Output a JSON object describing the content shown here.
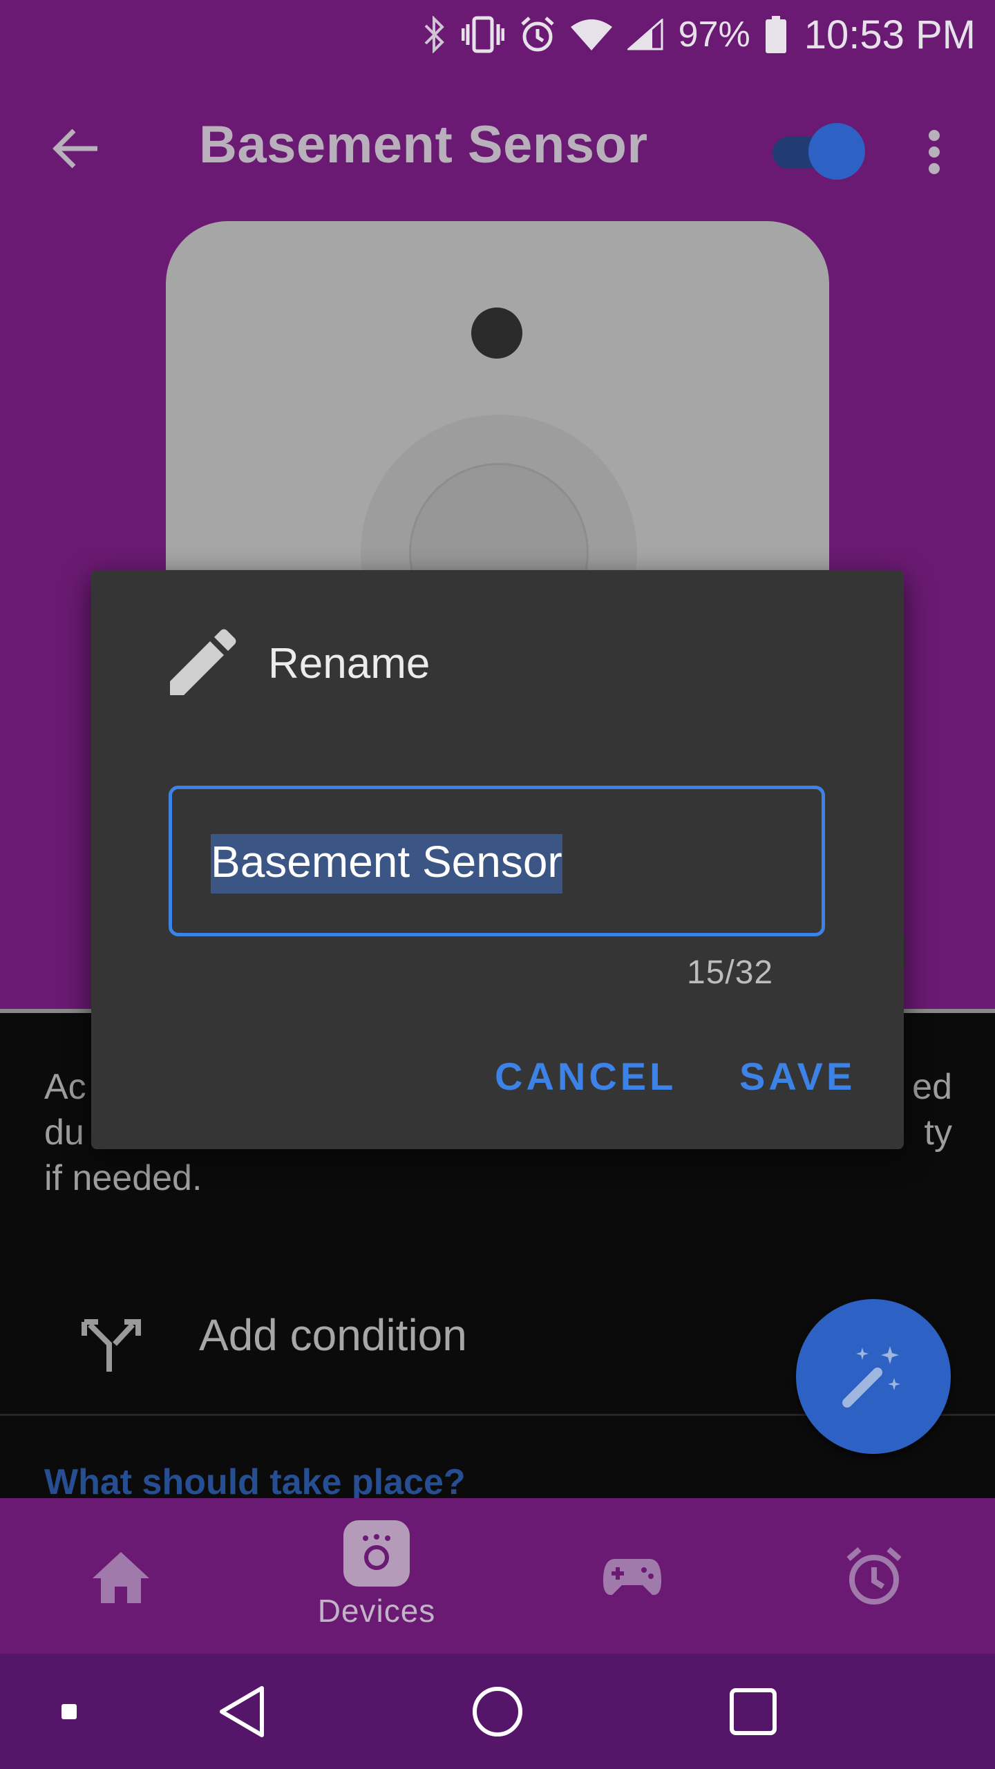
{
  "status_bar": {
    "battery_percent": "97%",
    "time": "10:53 PM",
    "icons": [
      "bluetooth-icon",
      "vibrate-icon",
      "alarm-icon",
      "wifi-icon",
      "signal-icon",
      "battery-icon"
    ]
  },
  "app_bar": {
    "title": "Basement Sensor",
    "enabled_toggle": true
  },
  "content": {
    "description": "Ac                                                          ed du                                                          ty if needed.",
    "description_line3": "if needed.",
    "description_left1": "Ac",
    "description_right1": "ed",
    "description_left2": "du",
    "description_right2": "ty",
    "add_condition_label": "Add condition",
    "section_heading": "What should take place?"
  },
  "dialog": {
    "title": "Rename",
    "input_value": "Basement Sensor",
    "counter": "15/32",
    "cancel_label": "CANCEL",
    "save_label": "SAVE"
  },
  "bottom_nav": {
    "items": [
      {
        "icon": "home-icon",
        "label": ""
      },
      {
        "icon": "devices-icon",
        "label": "Devices"
      },
      {
        "icon": "gamepad-icon",
        "label": ""
      },
      {
        "icon": "alarm-clock-icon",
        "label": ""
      }
    ],
    "selected": "Devices"
  },
  "colors": {
    "primary_purple": "#6a1a72",
    "accent_blue": "#3d82e6",
    "dialog_bg": "#353535"
  }
}
